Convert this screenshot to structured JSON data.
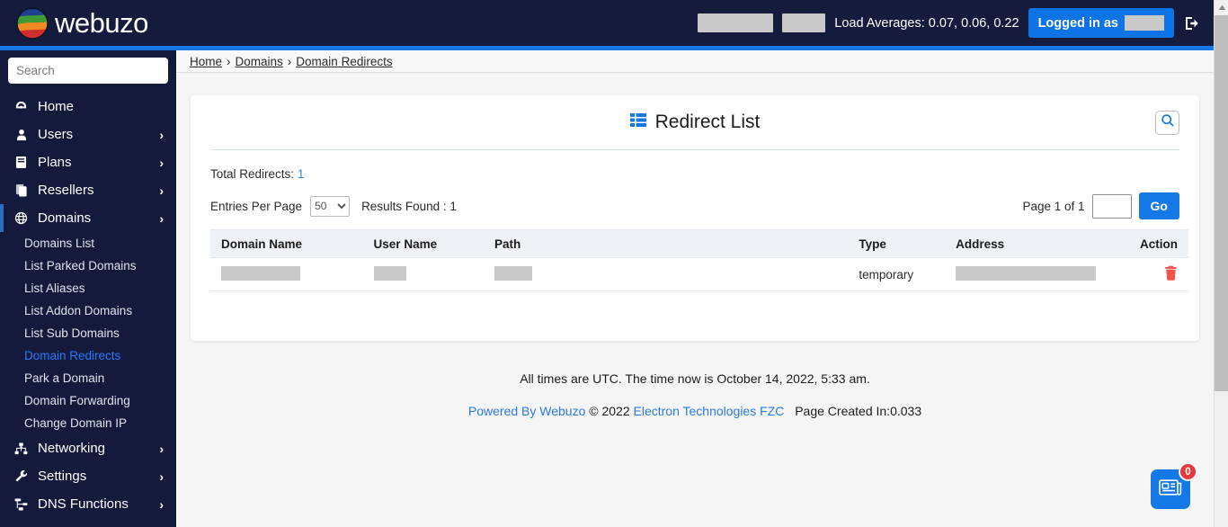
{
  "topbar": {
    "logo_text": "webuzo",
    "logo_icon": "globe-swirl-logo",
    "redacted_a": "",
    "redacted_b": "",
    "load_averages": "Load Averages: 0.07, 0.06, 0.22",
    "logged_in_label": "Logged in as",
    "logged_in_user_redacted": "",
    "logout_icon": "logout-icon"
  },
  "sidebar": {
    "search_placeholder": "Search",
    "search_value": "",
    "items": [
      {
        "label": "Home",
        "icon": "dashboard-icon",
        "chevron": "",
        "active": false
      },
      {
        "label": "Users",
        "icon": "user-icon",
        "chevron": "›",
        "active": false
      },
      {
        "label": "Plans",
        "icon": "plans-icon",
        "chevron": "›",
        "active": false
      },
      {
        "label": "Resellers",
        "icon": "resellers-icon",
        "chevron": "›",
        "active": false
      },
      {
        "label": "Domains",
        "icon": "globe-icon",
        "chevron": "›",
        "active": true
      }
    ],
    "sub_items": [
      {
        "label": "Domains List",
        "active": false
      },
      {
        "label": "List Parked Domains",
        "active": false
      },
      {
        "label": "List Aliases",
        "active": false
      },
      {
        "label": "List Addon Domains",
        "active": false
      },
      {
        "label": "List Sub Domains",
        "active": false
      },
      {
        "label": "Domain Redirects",
        "active": true
      },
      {
        "label": "Park a Domain",
        "active": false
      },
      {
        "label": "Domain Forwarding",
        "active": false
      },
      {
        "label": "Change Domain IP",
        "active": false
      }
    ],
    "items_bottom": [
      {
        "label": "Networking",
        "icon": "network-icon",
        "chevron": "›"
      },
      {
        "label": "Settings",
        "icon": "wrench-icon",
        "chevron": "›"
      },
      {
        "label": "DNS Functions",
        "icon": "dns-icon",
        "chevron": "›"
      }
    ]
  },
  "breadcrumb": {
    "home": "Home",
    "domains": "Domains",
    "current": "Domain Redirects",
    "separator": "›"
  },
  "card": {
    "title": "Redirect List",
    "title_icon": "list-icon",
    "search_icon": "search-icon",
    "total_label": "Total Redirects:",
    "total_count": "1",
    "entries_per_page_label": "Entries Per Page",
    "entries_per_page_value": "50",
    "entries_per_page_options": [
      "50"
    ],
    "results_found": "Results Found : 1",
    "page_label": "Page 1 of 1",
    "page_input_value": "",
    "go_label": "Go"
  },
  "table": {
    "columns": [
      "Domain Name",
      "User Name",
      "Path",
      "Type",
      "Address",
      "Action"
    ],
    "rows": [
      {
        "domain_name": "",
        "user_name": "",
        "path": "",
        "type": "temporary",
        "address": "",
        "action_icon": "trash-icon"
      }
    ]
  },
  "footer": {
    "utc_line": "All times are UTC. The time now is October 14, 2022, 5:33 am.",
    "powered_by": "Powered By Webuzo",
    "copyright": "© 2022",
    "company": "Electron Technologies FZC",
    "page_created": "Page Created In:0.033"
  },
  "fab": {
    "icon": "news-icon",
    "badge": "0"
  },
  "colors": {
    "navy": "#151b3d",
    "accent_blue": "#1478e6",
    "link_blue": "#2a7ae2",
    "active_item": "#2979ff",
    "danger_red": "#f4524d",
    "badge_red": "#e03a3a",
    "teal_count": "#2e8bc8"
  }
}
